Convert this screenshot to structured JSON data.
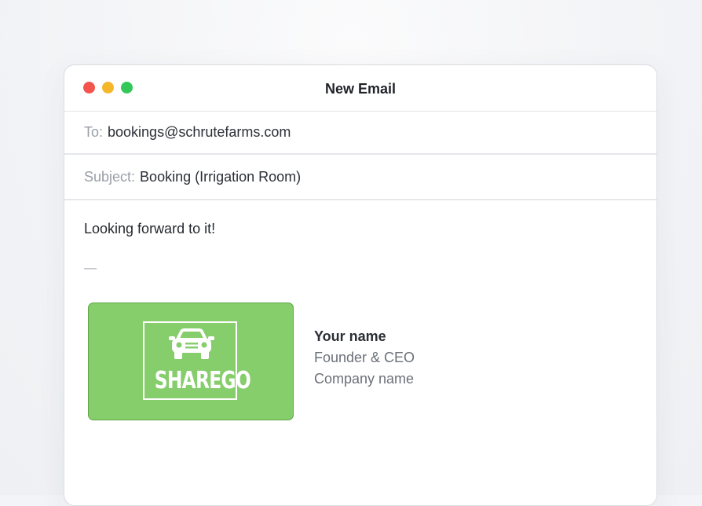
{
  "window": {
    "title": "New Email"
  },
  "to": {
    "label": "To:",
    "value": "bookings@schrutefarms.com"
  },
  "subject": {
    "label": "Subject:",
    "value": "Booking (Irrigation Room)"
  },
  "body": {
    "message": "Looking forward to it!",
    "separator": "—"
  },
  "signature": {
    "logo_text": "SHAREGO",
    "logo_icon": "car-icon",
    "name": "Your name",
    "role": "Founder & CEO",
    "company": "Company name"
  },
  "colors": {
    "close": "#f3544c",
    "minimize": "#f5b72a",
    "maximize": "#34c759",
    "logo_background": "#86cd6c"
  }
}
